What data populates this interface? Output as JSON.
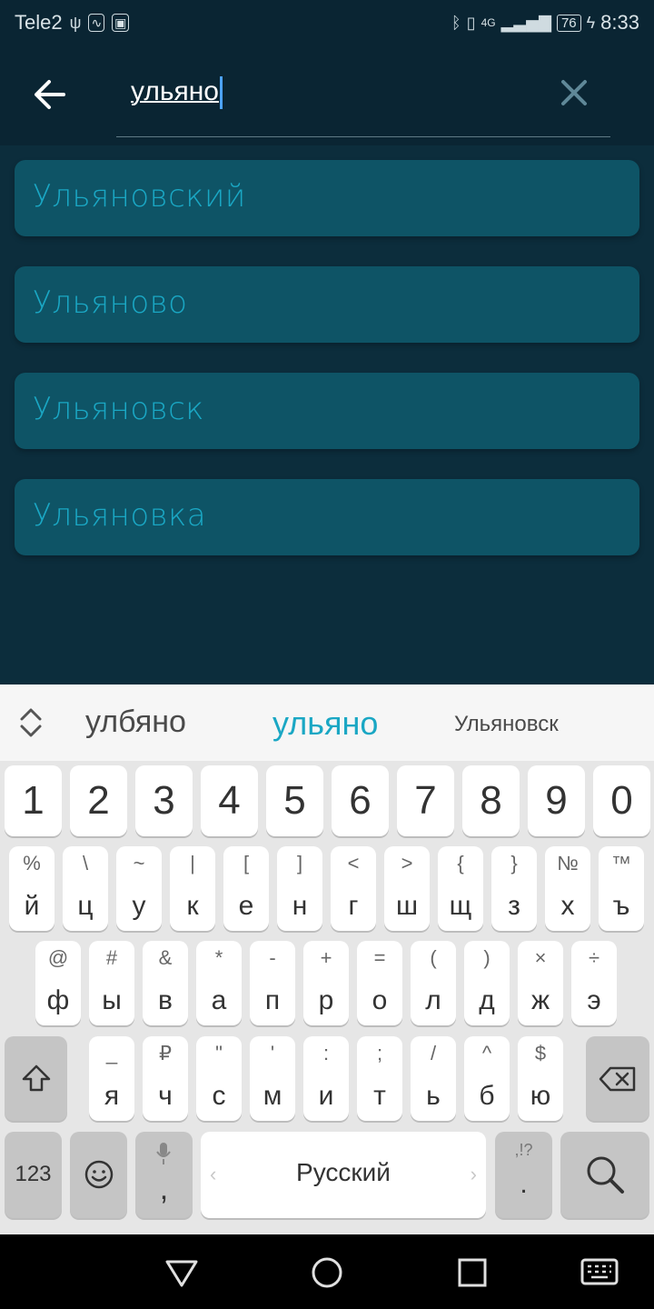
{
  "status_bar": {
    "carrier": "Tele2",
    "network": "4G",
    "battery": "76",
    "time": "8:33"
  },
  "search": {
    "query": "ульяно"
  },
  "results": [
    {
      "label": "Ульяновский"
    },
    {
      "label": "Ульяново"
    },
    {
      "label": "Ульяновск"
    },
    {
      "label": "Ульяновка"
    }
  ],
  "suggestions": {
    "left": "улбяно",
    "center": "ульяно",
    "right": "Ульяновск"
  },
  "keyboard": {
    "numbers": [
      "1",
      "2",
      "3",
      "4",
      "5",
      "6",
      "7",
      "8",
      "9",
      "0"
    ],
    "row1": [
      {
        "hint": "%",
        "main": "й"
      },
      {
        "hint": "\\",
        "main": "ц"
      },
      {
        "hint": "~",
        "main": "у"
      },
      {
        "hint": "|",
        "main": "к"
      },
      {
        "hint": "[",
        "main": "е"
      },
      {
        "hint": "]",
        "main": "н"
      },
      {
        "hint": "<",
        "main": "г"
      },
      {
        "hint": ">",
        "main": "ш"
      },
      {
        "hint": "{",
        "main": "щ"
      },
      {
        "hint": "}",
        "main": "з"
      },
      {
        "hint": "№",
        "main": "х"
      },
      {
        "hint": "™",
        "main": "ъ"
      }
    ],
    "row2": [
      {
        "hint": "@",
        "main": "ф"
      },
      {
        "hint": "#",
        "main": "ы"
      },
      {
        "hint": "&",
        "main": "в"
      },
      {
        "hint": "*",
        "main": "а"
      },
      {
        "hint": "-",
        "main": "п"
      },
      {
        "hint": "+",
        "main": "р"
      },
      {
        "hint": "=",
        "main": "о"
      },
      {
        "hint": "(",
        "main": "л"
      },
      {
        "hint": ")",
        "main": "д"
      },
      {
        "hint": "×",
        "main": "ж"
      },
      {
        "hint": "÷",
        "main": "э"
      }
    ],
    "row3": [
      {
        "hint": "_",
        "main": "я"
      },
      {
        "hint": "₽",
        "main": "ч"
      },
      {
        "hint": "\"",
        "main": "с"
      },
      {
        "hint": "'",
        "main": "м"
      },
      {
        "hint": ":",
        "main": "и"
      },
      {
        "hint": ";",
        "main": "т"
      },
      {
        "hint": "/",
        "main": "ь"
      },
      {
        "hint": "^",
        "main": "б"
      },
      {
        "hint": "$",
        "main": "ю"
      }
    ],
    "symbols_label": "123",
    "comma": ",",
    "space_label": "Русский",
    "period": ".",
    "punct_hint": ",!?"
  },
  "colors": {
    "background": "#0c2d3c",
    "result_bg": "#0e5466",
    "result_text": "#1aa7c4",
    "suggest_active": "#1aa7c4"
  }
}
